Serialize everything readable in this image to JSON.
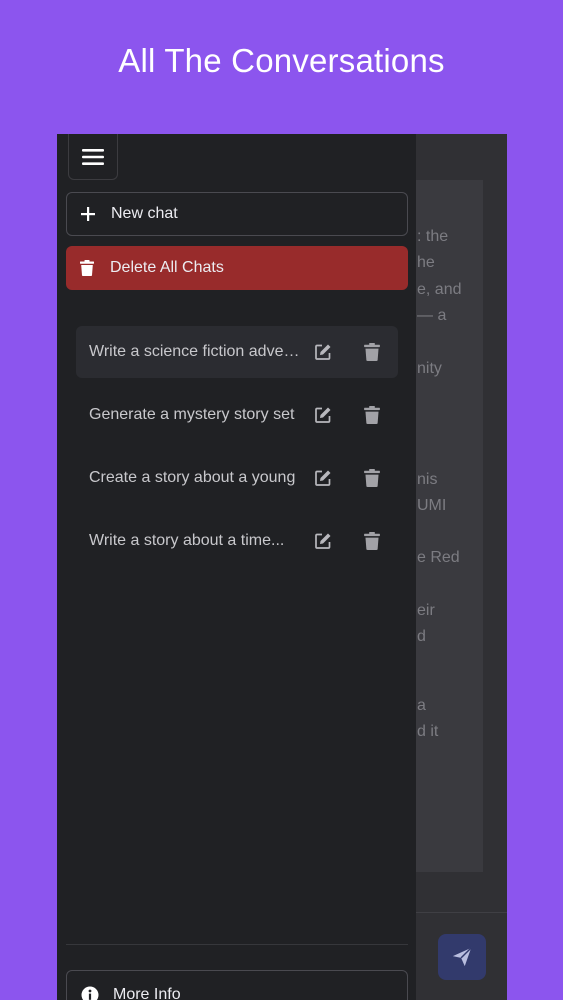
{
  "headline": "All The Conversations",
  "colors": {
    "page_bg": "#8c55ee",
    "sidebar_bg": "#202124",
    "delete_all_bg": "#982b2b",
    "send_button_bg": "#323a6c"
  },
  "header": {
    "menu_icon": "hamburger-icon"
  },
  "sidebar": {
    "new_chat": {
      "label": "New chat",
      "icon": "plus-icon"
    },
    "delete_all": {
      "label": "Delete All Chats",
      "icon": "trash-icon"
    },
    "conversations": [
      {
        "title": "Write a science fiction adventure",
        "active": true
      },
      {
        "title": "Generate a mystery story set",
        "active": false
      },
      {
        "title": "Create a story about a young",
        "active": false
      },
      {
        "title": "Write a story about a time...",
        "active": false
      }
    ],
    "more_info": {
      "label": "More Info",
      "icon": "info-icon"
    }
  },
  "background_chat": {
    "fragments": [
      ": the",
      "he",
      "e, and",
      "— a",
      "nity",
      "nis",
      "UMI",
      "e Red",
      "eir",
      "d",
      "a",
      "d it"
    ]
  },
  "composer": {
    "send_icon": "send-icon"
  }
}
